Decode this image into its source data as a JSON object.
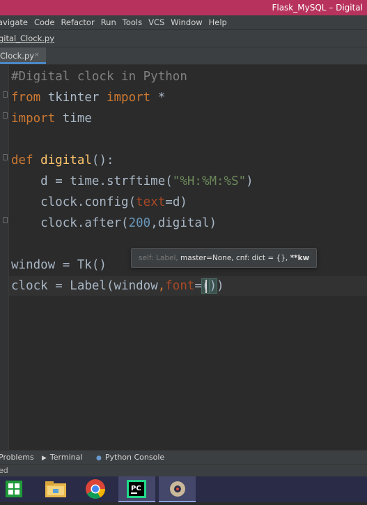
{
  "window": {
    "title": "Flask_MySQL – Digital"
  },
  "menu": [
    "avigate",
    "Code",
    "Refactor",
    "Run",
    "Tools",
    "VCS",
    "Window",
    "Help"
  ],
  "breadcrumb": "gital_Clock.py",
  "tab": {
    "label": "Clock.py",
    "close": "×"
  },
  "code": [
    [
      {
        "t": "#Digital clock in Python",
        "c": "cm"
      }
    ],
    [
      {
        "t": "from",
        "c": "kw"
      },
      {
        "t": " tkinter "
      },
      {
        "t": "import",
        "c": "kw"
      },
      {
        "t": " *"
      }
    ],
    [
      {
        "t": "import",
        "c": "kw"
      },
      {
        "t": " time"
      }
    ],
    [],
    [
      {
        "t": "def",
        "c": "kw"
      },
      {
        "t": " "
      },
      {
        "t": "digital",
        "c": "fn"
      },
      {
        "t": "():"
      }
    ],
    [
      {
        "t": "    d = time.strftime("
      },
      {
        "t": "\"%H:%M:%S\"",
        "c": "str"
      },
      {
        "t": ")"
      }
    ],
    [
      {
        "t": "    clock.config("
      },
      {
        "t": "text",
        "c": "prm"
      },
      {
        "t": "=d)"
      }
    ],
    [
      {
        "t": "    clock.after("
      },
      {
        "t": "200",
        "c": "num"
      },
      {
        "t": ",digital)"
      }
    ],
    [],
    [
      {
        "t": "window = Tk()"
      }
    ],
    [
      {
        "t": "clock = Label(window"
      },
      {
        "t": ",",
        "c": "kw"
      },
      {
        "t": "font",
        "c": "prm"
      },
      {
        "t": "="
      },
      {
        "t": "(",
        "c": "brace"
      },
      {
        "t": "",
        "c": "caret"
      },
      {
        "t": ")",
        "c": "brace"
      },
      {
        "t": ")"
      }
    ]
  ],
  "tooltip": {
    "dim": "self: Label,",
    "main": " master=None, cnf: dict = {}, ",
    "bold": "**kw"
  },
  "toolwindows": [
    {
      "name": "problems",
      "label": "Problems",
      "icon": ""
    },
    {
      "name": "terminal",
      "label": "Terminal",
      "icon": "▶"
    },
    {
      "name": "python-console",
      "label": "Python Console",
      "icon": "●"
    }
  ],
  "status": "ed",
  "colors": {
    "accent": "#4a88c7",
    "titlebar": "#b8325e",
    "taskbar": "#2a2b47"
  }
}
